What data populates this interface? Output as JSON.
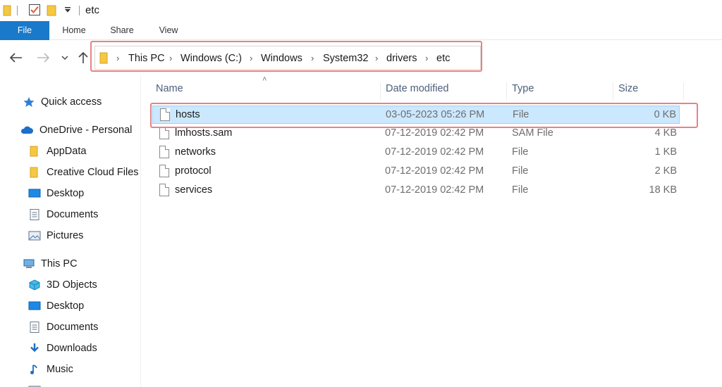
{
  "window": {
    "title": "etc"
  },
  "ribbon": {
    "tabs": [
      "File",
      "Home",
      "Share",
      "View"
    ]
  },
  "address": {
    "crumbs": [
      "This PC",
      "Windows (C:)",
      "Windows",
      "System32",
      "drivers",
      "etc"
    ]
  },
  "sidebar": {
    "items": [
      {
        "label": "Quick access",
        "icon": "star-icon"
      },
      {
        "label": "OneDrive - Personal",
        "icon": "cloud-icon"
      },
      {
        "label": "AppData",
        "icon": "folder-icon"
      },
      {
        "label": "Creative Cloud Files",
        "icon": "folder-icon"
      },
      {
        "label": "Desktop",
        "icon": "desktop-icon"
      },
      {
        "label": "Documents",
        "icon": "documents-icon"
      },
      {
        "label": "Pictures",
        "icon": "pictures-icon"
      },
      {
        "label": "This PC",
        "icon": "computer-icon"
      },
      {
        "label": "3D Objects",
        "icon": "cube-icon"
      },
      {
        "label": "Desktop",
        "icon": "desktop-icon"
      },
      {
        "label": "Documents",
        "icon": "documents-icon"
      },
      {
        "label": "Downloads",
        "icon": "download-icon"
      },
      {
        "label": "Music",
        "icon": "music-icon"
      }
    ]
  },
  "list": {
    "columns": [
      "Name",
      "Date modified",
      "Type",
      "Size"
    ],
    "rows": [
      {
        "name": "hosts",
        "date": "03-05-2023 05:26 PM",
        "type": "File",
        "size": "0 KB",
        "selected": true
      },
      {
        "name": "lmhosts.sam",
        "date": "07-12-2019 02:42 PM",
        "type": "SAM File",
        "size": "4 KB"
      },
      {
        "name": "networks",
        "date": "07-12-2019 02:42 PM",
        "type": "File",
        "size": "1 KB"
      },
      {
        "name": "protocol",
        "date": "07-12-2019 02:42 PM",
        "type": "File",
        "size": "2 KB"
      },
      {
        "name": "services",
        "date": "07-12-2019 02:42 PM",
        "type": "File",
        "size": "18 KB"
      }
    ]
  },
  "colors": {
    "accent": "#1979ca",
    "selection": "#cce8ff",
    "highlight": "#e88284"
  }
}
